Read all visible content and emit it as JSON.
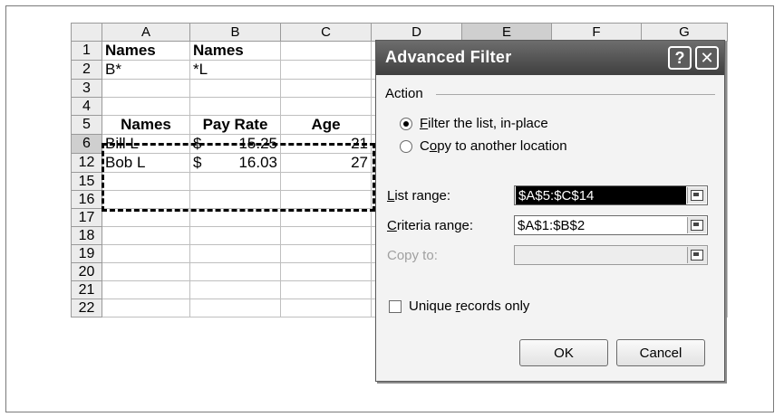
{
  "spreadsheet": {
    "columns": [
      "A",
      "B",
      "C",
      "D",
      "E",
      "F",
      "G"
    ],
    "rows": [
      {
        "num": "1",
        "cells": [
          "Names",
          "Names",
          ""
        ]
      },
      {
        "num": "2",
        "cells": [
          "B*",
          "*L",
          ""
        ]
      },
      {
        "num": "3",
        "cells": [
          "",
          "",
          ""
        ]
      },
      {
        "num": "4",
        "cells": [
          "",
          "",
          ""
        ]
      },
      {
        "num": "5",
        "cells": [
          "Names",
          "Pay Rate",
          "Age"
        ]
      },
      {
        "num": "6",
        "cells": [
          "Bill L",
          "$",
          "15.25",
          "21"
        ]
      },
      {
        "num": "12",
        "cells": [
          "Bob L",
          "$",
          "16.03",
          "27"
        ]
      },
      {
        "num": "15"
      },
      {
        "num": "16"
      },
      {
        "num": "17"
      },
      {
        "num": "18"
      },
      {
        "num": "19"
      },
      {
        "num": "20"
      },
      {
        "num": "21"
      },
      {
        "num": "22"
      }
    ]
  },
  "dialog": {
    "title": "Advanced Filter",
    "help_glyph": "?",
    "close_glyph": "✕",
    "action_label": "Action",
    "radio_filter_prefix": "",
    "radio_filter_u": "F",
    "radio_filter_rest": "ilter the list, in-place",
    "radio_copy_prefix": "C",
    "radio_copy_u": "o",
    "radio_copy_rest": "py to another location",
    "list_range_u": "L",
    "list_range_rest": "ist range:",
    "list_range_value": "$A$5:$C$14",
    "criteria_range_u": "C",
    "criteria_range_rest": "riteria range:",
    "criteria_range_value": "$A$1:$B$2",
    "copy_to_label": "Copy to:",
    "copy_to_value": "",
    "unique_prefix": "Unique ",
    "unique_u": "r",
    "unique_rest": "ecords only",
    "ok_label": "OK",
    "cancel_label": "Cancel"
  }
}
